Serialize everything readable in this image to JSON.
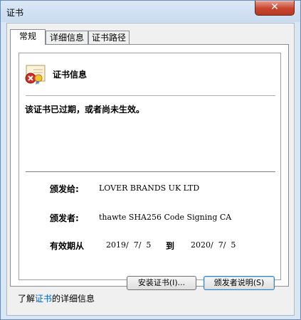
{
  "window": {
    "title": "证书",
    "close_glyph": "✕"
  },
  "tabs": [
    {
      "label": "常规"
    },
    {
      "label": "详细信息"
    },
    {
      "label": "证书路径"
    }
  ],
  "cert_info": {
    "icon": "certificate-error-icon",
    "header": "证书信息",
    "status": "该证书已过期，或者尚未生效。",
    "issued_to_label": "颁发给:",
    "issued_to_value": "LOVER BRANDS UK LTD",
    "issued_by_label": "颁发者:",
    "issued_by_value": "thawte SHA256 Code Signing CA",
    "validity_label": "有效期从",
    "valid_from": "2019/  7/  5",
    "to_label": "到",
    "valid_to": "2020/  7/  5"
  },
  "buttons": {
    "install": "安装证书(I)...",
    "issuer_statement": "颁发者说明(S)"
  },
  "learn_more": {
    "prefix": "了解",
    "link": "证书",
    "suffix": "的详细信息"
  },
  "colors": {
    "close_button": "#c8442e",
    "link": "#0066cc"
  }
}
